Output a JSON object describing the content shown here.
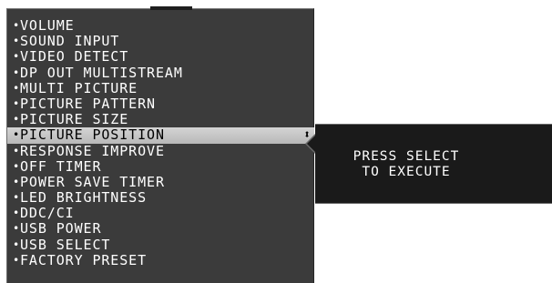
{
  "menu": {
    "items": [
      {
        "label": "VOLUME"
      },
      {
        "label": "SOUND INPUT"
      },
      {
        "label": "VIDEO DETECT"
      },
      {
        "label": "DP OUT MULTISTREAM"
      },
      {
        "label": "MULTI PICTURE"
      },
      {
        "label": "PICTURE PATTERN"
      },
      {
        "label": "PICTURE SIZE"
      },
      {
        "label": "PICTURE POSITION",
        "selected": true
      },
      {
        "label": "RESPONSE IMPROVE"
      },
      {
        "label": "OFF TIMER"
      },
      {
        "label": "POWER SAVE TIMER"
      },
      {
        "label": "LED BRIGHTNESS"
      },
      {
        "label": "DDC/CI"
      },
      {
        "label": "USB POWER"
      },
      {
        "label": "USB SELECT"
      },
      {
        "label": "FACTORY PRESET"
      }
    ],
    "bullet": "•",
    "updown_icon": "up-down-arrows-icon",
    "updown_glyph": "⬍"
  },
  "popup": {
    "line1": "PRESS SELECT",
    "line2": "TO EXECUTE"
  },
  "colors": {
    "menu_bg": "#3b3b3b",
    "selected_bg": "#c6c6c6",
    "popup_bg": "#1a1a1a",
    "text": "#ffffff"
  }
}
